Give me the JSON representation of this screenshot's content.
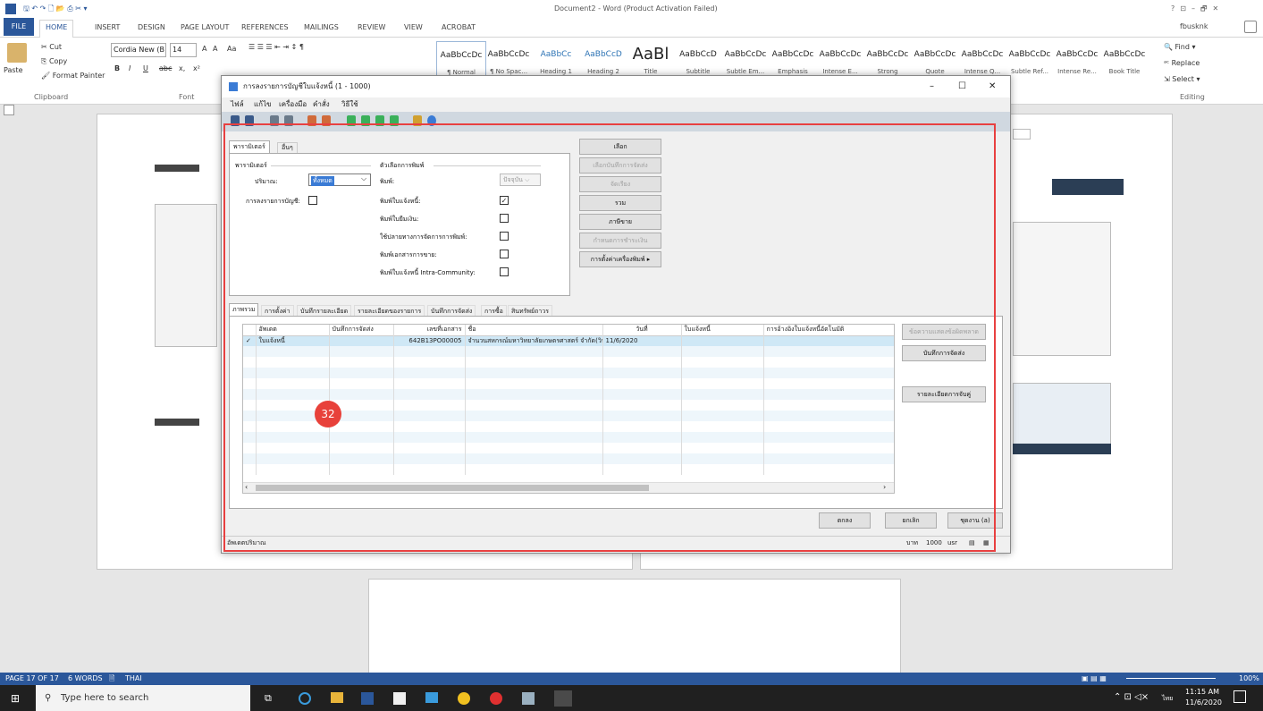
{
  "window_title": "Document2 - Word (Product Activation Failed)",
  "title_controls": [
    "?",
    "⊡",
    "–",
    "🗗",
    "✕"
  ],
  "user": "fbusknk",
  "ribbon_tabs": [
    "FILE",
    "HOME",
    "INSERT",
    "DESIGN",
    "PAGE LAYOUT",
    "REFERENCES",
    "MAILINGS",
    "REVIEW",
    "VIEW",
    "ACROBAT"
  ],
  "clipboard": {
    "paste": "Paste",
    "cut": "Cut",
    "copy": "Copy",
    "format_painter": "Format Painter",
    "group": "Clipboard"
  },
  "font": {
    "name": "Cordia New (B",
    "size": "14",
    "group": "Font",
    "grow": "A",
    "shrink": "A",
    "case": "Aa",
    "bold": "B",
    "italic": "I",
    "underline": "U",
    "strike": "abc",
    "sub": "x,",
    "sup": "x²"
  },
  "styles": [
    {
      "preview": "AaBbCcDc",
      "label": "¶ Normal"
    },
    {
      "preview": "AaBbCcDc",
      "label": "¶ No Spac..."
    },
    {
      "preview": "AaBbCc",
      "label": "Heading 1"
    },
    {
      "preview": "AaBbCcD",
      "label": "Heading 2"
    },
    {
      "preview": "AaBl",
      "label": "Title"
    },
    {
      "preview": "AaBbCcD",
      "label": "Subtitle"
    },
    {
      "preview": "AaBbCcDc",
      "label": "Subtle Em..."
    },
    {
      "preview": "AaBbCcDc",
      "label": "Emphasis"
    },
    {
      "preview": "AaBbCcDc",
      "label": "Intense E..."
    },
    {
      "preview": "AaBbCcDc",
      "label": "Strong"
    },
    {
      "preview": "AaBbCcDc",
      "label": "Quote"
    },
    {
      "preview": "AaBbCcDc",
      "label": "Intense Q..."
    },
    {
      "preview": "AaBbCcDc",
      "label": "Subtle Ref..."
    },
    {
      "preview": "AaBbCcDc",
      "label": "Intense Re..."
    },
    {
      "preview": "AaBbCcDc",
      "label": "Book Title"
    }
  ],
  "editing": {
    "find": "Find",
    "replace": "Replace",
    "select": "Select",
    "group": "Editing"
  },
  "dialog": {
    "title": "การลงรายการบัญชีใบแจ้งหนี้ (1 - 1000)",
    "controls": [
      "–",
      "☐",
      "✕"
    ],
    "menu": [
      "ไฟล์",
      "แก้ไข",
      "เครื่องมือ",
      "คำสั่ง",
      "วิธีใช้"
    ],
    "tabs_top": [
      "พารามิเตอร์",
      "อื่นๆ"
    ],
    "params_group": "พารามิเตอร์",
    "quantity_label": "ปริมาณ:",
    "quantity_value": "ทั้งหมด",
    "posting_label": "การลงรายการบัญชี:",
    "print_group": "ตัวเลือกการพิมพ์",
    "print_label": "พิมพ์:",
    "print_value": "ปัจจุบัน",
    "print_options": [
      {
        "label": "พิมพ์ใบแจ้งหนี้:",
        "checked": "✓"
      },
      {
        "label": "พิมพ์ใบยืมเงิน:",
        "checked": ""
      },
      {
        "label": "ใช้ปลายทางการจัดการการพิมพ์:",
        "checked": ""
      },
      {
        "label": "พิมพ์เอกสารการขาย:",
        "checked": ""
      },
      {
        "label": "พิมพ์ใบแจ้งหนี้ Intra-Community:",
        "checked": ""
      }
    ],
    "right_buttons": [
      {
        "label": "เลือก",
        "disabled": false
      },
      {
        "label": "เลือกบันทึกการจัดส่ง",
        "disabled": true
      },
      {
        "label": "จัดเรียง",
        "disabled": true
      },
      {
        "label": "รวม",
        "disabled": false
      },
      {
        "label": "ภาษีขาย",
        "disabled": false
      },
      {
        "label": "กำหนดการชำระเงิน",
        "disabled": true
      },
      {
        "label": "การตั้งค่าเครื่องพิมพ์ ▸",
        "disabled": false
      }
    ],
    "tabs_bottom": [
      "ภาพรวม",
      "การตั้งค่า",
      "บันทึกรายละเอียด",
      "รายละเอียดของรายการ",
      "บันทึกการจัดส่ง",
      "การซื้อ",
      "สินทรัพย์ถาวร"
    ],
    "grid_headers": [
      "อัพเดต",
      "บันทึกการจัดส่ง",
      "เลขที่เอกสาร",
      "ชื่อ",
      "วันที่",
      "ใบแจ้งหนี้",
      "การอ้างอิงใบแจ้งหนี้อัตโนมัติ"
    ],
    "grid_rows": [
      {
        "check": "✓",
        "update": "ใบแจ้งหนี้",
        "shipping": "",
        "doc": "642B13PO00005",
        "name": "จำนวนสหกรณ์มหาวิทยาลัยเกษตรศาสตร์ จำกัด(วิทยาเ...",
        "date": "11/6/2020",
        "invoice": "",
        "ref": ""
      }
    ],
    "grid_side_buttons": [
      {
        "label": "ข้อความแสดงข้อผิดพลาด",
        "disabled": true
      },
      {
        "label": "บันทึกการจัดส่ง",
        "disabled": false
      },
      {
        "label": "รายละเอียดการจับคู่",
        "disabled": false
      }
    ],
    "step_marker": "32",
    "footer_buttons": [
      "ตกลง",
      "ยกเลิก",
      "ชุดงาน (a)"
    ],
    "status_left": "อัพเดตปริมาณ",
    "status_currency": "บาท",
    "status_company": "1000",
    "status_user": "usr"
  },
  "statusbar": {
    "page": "PAGE 17 OF 17",
    "words": "6 WORDS",
    "lang": "THAI",
    "zoom": "100%"
  },
  "taskbar": {
    "search": "Type here to search",
    "time": "11:15 AM",
    "date": "11/6/2020",
    "lang": "ไทย"
  },
  "colors": {
    "word_blue": "#2b579a",
    "highlight_red": "#e84040",
    "marker_red": "#e8413a"
  }
}
